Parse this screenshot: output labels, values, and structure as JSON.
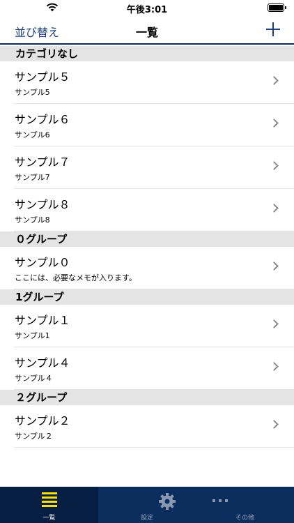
{
  "status_bar": {
    "time": "午後3:01"
  },
  "nav": {
    "sort_label": "並び替え",
    "title": "一覧"
  },
  "sections": [
    {
      "header": "カテゴリなし",
      "rows": [
        {
          "title": "サンプル５",
          "subtitle": "サンプル5"
        },
        {
          "title": "サンプル６",
          "subtitle": "サンプル6"
        },
        {
          "title": "サンプル７",
          "subtitle": "サンプル7"
        },
        {
          "title": "サンプル８",
          "subtitle": "サンプル8"
        }
      ]
    },
    {
      "header": "０グループ",
      "rows": [
        {
          "title": "サンプル０",
          "subtitle": "ここには、必要なメモが入ります。"
        }
      ]
    },
    {
      "header": "1グループ",
      "rows": [
        {
          "title": "サンプル１",
          "subtitle": "サンプル1"
        },
        {
          "title": "サンプル４",
          "subtitle": "サンプル４"
        }
      ]
    },
    {
      "header": "２グループ",
      "rows": [
        {
          "title": "サンプル２",
          "subtitle": "サンプル２"
        }
      ]
    }
  ],
  "tabs": [
    {
      "label": "一覧",
      "icon": "list-icon",
      "selected": true
    },
    {
      "label": "設定",
      "icon": "gear-icon",
      "selected": false
    },
    {
      "label": "その他",
      "icon": "more-icon",
      "selected": false
    }
  ],
  "colors": {
    "accent": "#1e3f7a",
    "tab_bar": "#0b2e5f",
    "tab_icon_active": "#ffe000",
    "section_header_bg": "#e4e4e4"
  }
}
